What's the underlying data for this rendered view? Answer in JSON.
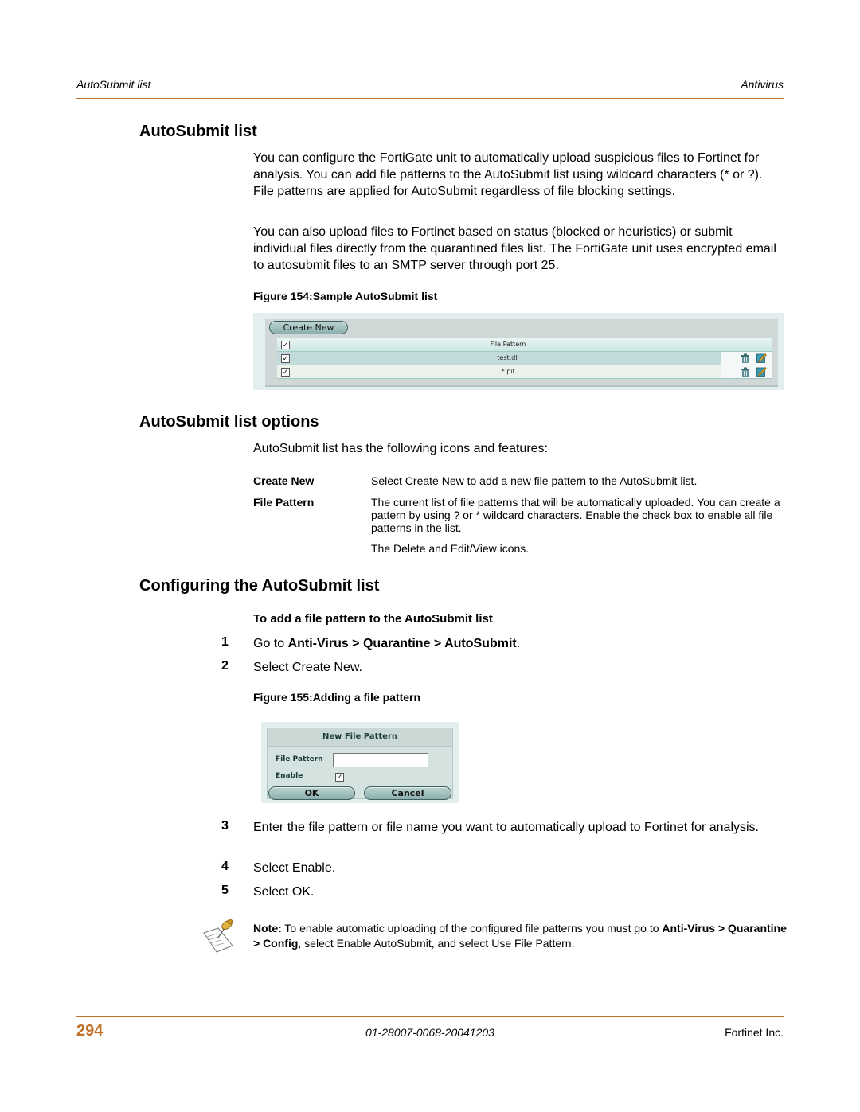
{
  "header": {
    "left": "AutoSubmit list",
    "right": "Antivirus"
  },
  "sections": {
    "autosubmit_list": {
      "title": "AutoSubmit list",
      "paragraphs": [
        "You can configure the FortiGate unit to automatically upload suspicious files to Fortinet for analysis. You can add file patterns to the AutoSubmit list using wildcard characters (* or ?). File patterns are applied for AutoSubmit regardless of file blocking settings.",
        "You can also upload files to Fortinet based on status (blocked or heuristics) or submit individual files directly from the quarantined files list. The FortiGate unit uses encrypted email to autosubmit files to an SMTP server through port 25."
      ],
      "figure_caption": "Figure 154:Sample AutoSubmit list"
    },
    "options": {
      "title": "AutoSubmit list options",
      "intro": "AutoSubmit list has the following icons and features:",
      "definitions": [
        {
          "term": "Create New",
          "text": "Select Create New to add a new file pattern to the AutoSubmit list."
        },
        {
          "term": "File Pattern",
          "text": "The current list of file patterns that will be automatically uploaded. You can create a pattern by using ? or * wildcard characters. Enable the check box to enable all file patterns in the list."
        },
        {
          "term": "",
          "text": "The Delete and Edit/View icons."
        }
      ]
    },
    "configuring": {
      "title": "Configuring the AutoSubmit list",
      "procedure_title": "To add a file pattern to the AutoSubmit list",
      "step1": {
        "num": "1",
        "prefix": "Go to ",
        "path": "Anti-Virus > Quarantine > AutoSubmit",
        "suffix": "."
      },
      "step2": {
        "num": "2",
        "text": "Select Create New."
      },
      "figure_caption": "Figure 155:Adding a file pattern",
      "step3": {
        "num": "3",
        "text": "Enter the file pattern or file name you want to automatically upload to Fortinet for analysis."
      },
      "step4": {
        "num": "4",
        "text": "Select Enable."
      },
      "step5": {
        "num": "5",
        "text": "Select OK."
      }
    }
  },
  "figure154": {
    "create_new_label": "Create New",
    "column_header": "File Pattern",
    "header_checked": true,
    "rows": [
      {
        "pattern": "test.dll",
        "checked": true
      },
      {
        "pattern": "*.pif",
        "checked": true
      }
    ],
    "check_glyph": "✓"
  },
  "figure155": {
    "title": "New File Pattern",
    "file_pattern_label": "File Pattern",
    "file_pattern_value": "",
    "enable_label": "Enable",
    "enable_checked": true,
    "ok_label": "OK",
    "cancel_label": "Cancel",
    "check_glyph": "✓"
  },
  "note": {
    "label": "Note:",
    "text1": " To enable automatic uploading of the configured file patterns you must go to ",
    "bold1": "Anti-Virus > Quarantine > Config",
    "text2": ", select Enable AutoSubmit, and select Use File Pattern."
  },
  "footer": {
    "page_number": "294",
    "doc_id": "01-28007-0068-20041203",
    "company": "Fortinet Inc."
  },
  "colors": {
    "accent": "#c0722a"
  }
}
